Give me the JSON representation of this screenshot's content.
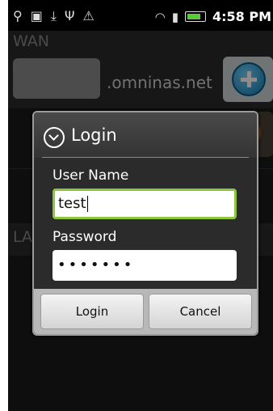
{
  "status_bar": {
    "time": "4:58 PM",
    "icons_left": [
      "location-alert-icon",
      "clipboard-icon",
      "download-icon",
      "usb-icon",
      "warning-icon"
    ],
    "icons_right": [
      "wifi-icon",
      "signal-icon",
      "battery-icon"
    ]
  },
  "background": {
    "wan_title": "WAN",
    "domain_suffix": ".omninas.net",
    "lan_title": "LAN"
  },
  "dialog": {
    "title": "Login",
    "username_label": "User Name",
    "username_value": "test",
    "password_label": "Password",
    "password_value": "•••••••",
    "login_button": "Login",
    "cancel_button": "Cancel"
  },
  "colors": {
    "focus_border": "#8cc63f",
    "add_button": "#1478b0",
    "orange_button": "#c86010"
  }
}
